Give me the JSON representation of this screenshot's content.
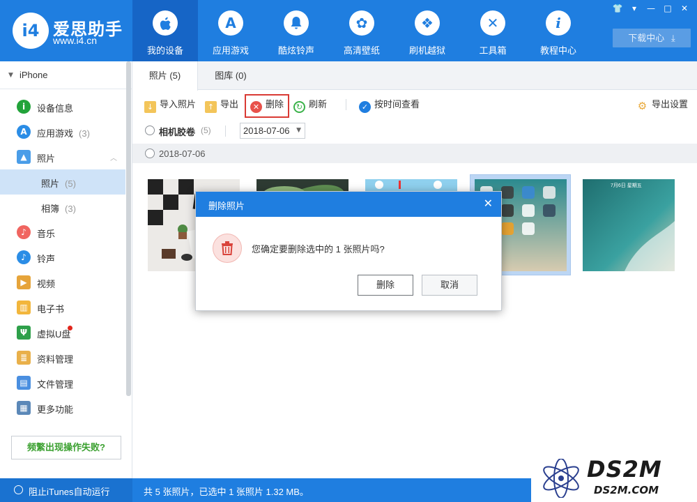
{
  "app": {
    "name": "爱思助手",
    "url": "www.i4.cn",
    "logo_mark": "i4"
  },
  "window_controls": [
    "shirt-icon",
    "menu-icon",
    "minimize-icon",
    "maximize-icon",
    "close-icon"
  ],
  "nav": {
    "items": [
      {
        "label": "我的设备",
        "icon": "apple-icon",
        "glyph": "",
        "active": true
      },
      {
        "label": "应用游戏",
        "icon": "app-store-icon",
        "glyph": "A",
        "active": false
      },
      {
        "label": "酷炫铃声",
        "icon": "bell-icon",
        "glyph": "♪",
        "active": false
      },
      {
        "label": "高清壁纸",
        "icon": "flower-icon",
        "glyph": "✿",
        "active": false
      },
      {
        "label": "刷机越狱",
        "icon": "dropbox-icon",
        "glyph": "❖",
        "active": false
      },
      {
        "label": "工具箱",
        "icon": "tools-icon",
        "glyph": "✕",
        "active": false
      },
      {
        "label": "教程中心",
        "icon": "info-icon",
        "glyph": "i",
        "active": false
      }
    ],
    "download_label": "下载中心"
  },
  "sidebar": {
    "device": "iPhone",
    "items": [
      {
        "label": "设备信息",
        "count": "",
        "icon": "info-circle-icon",
        "glyph": "i",
        "color": "#22a33a"
      },
      {
        "label": "应用游戏",
        "count": "(3)",
        "icon": "app-store-icon",
        "glyph": "A",
        "color": "#2b8de6"
      },
      {
        "label": "照片",
        "count": "",
        "icon": "photo-icon",
        "glyph": "▲",
        "color": "#4a9de8"
      },
      {
        "label": "音乐",
        "count": "",
        "icon": "music-icon",
        "glyph": "♪",
        "color": "#f06560"
      },
      {
        "label": "铃声",
        "count": "",
        "icon": "bell-icon",
        "glyph": "♪",
        "color": "#2b8de6"
      },
      {
        "label": "视频",
        "count": "",
        "icon": "video-icon",
        "glyph": "▶",
        "color": "#e6a43a"
      },
      {
        "label": "电子书",
        "count": "",
        "icon": "book-icon",
        "glyph": "▥",
        "color": "#f2b63c"
      },
      {
        "label": "虚拟U盘",
        "count": "",
        "icon": "usb-icon",
        "glyph": "Ψ",
        "color": "#2ea04a"
      },
      {
        "label": "资料管理",
        "count": "",
        "icon": "document-icon",
        "glyph": "≣",
        "color": "#e9b04a"
      },
      {
        "label": "文件管理",
        "count": "",
        "icon": "folder-icon",
        "glyph": "▤",
        "color": "#4a8fe0"
      },
      {
        "label": "更多功能",
        "count": "",
        "icon": "grid-icon",
        "glyph": "▦",
        "color": "#5b88b8"
      }
    ],
    "photo_subs": [
      {
        "label": "照片",
        "count": "(5)",
        "active": true
      },
      {
        "label": "相簿",
        "count": "(3)",
        "active": false
      }
    ],
    "help_button": "频繁出现操作失败?"
  },
  "tabs": [
    {
      "label": "照片 (5)",
      "active": true
    },
    {
      "label": "图库 (0)",
      "active": false
    }
  ],
  "toolbar": {
    "import": "导入照片",
    "export": "导出",
    "delete": "删除",
    "refresh": "刷新",
    "view_by_time": "按时间查看",
    "export_settings": "导出设置"
  },
  "filter": {
    "camera_roll": "相机胶卷",
    "camera_roll_count": "(5)",
    "date_value": "2018-07-06"
  },
  "group": {
    "date": "2018-07-06"
  },
  "photos": [
    {
      "name": "photo-1",
      "selected": false
    },
    {
      "name": "photo-2",
      "selected": false
    },
    {
      "name": "photo-3",
      "selected": false
    },
    {
      "name": "photo-4",
      "selected": true
    },
    {
      "name": "photo-5",
      "selected": false,
      "overlay_text": "7月6日 星期五"
    }
  ],
  "dialog": {
    "title": "删除照片",
    "message": "您确定要删除选中的 1 张照片吗?",
    "confirm": "删除",
    "cancel": "取消"
  },
  "status": {
    "itunes_toggle": "阻止iTunes自动运行",
    "info": "共 5 张照片，已选中 1 张照片 1.32 MB。"
  },
  "watermark": {
    "main": "DS2M",
    "sub": "DS2M.COM"
  }
}
